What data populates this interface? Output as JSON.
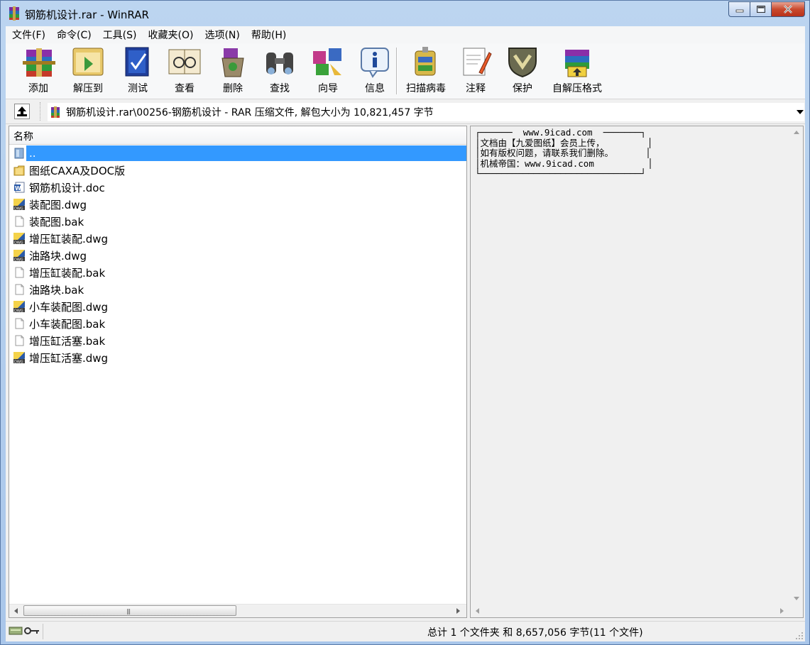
{
  "window": {
    "title": "钢筋机设计.rar - WinRAR"
  },
  "menu": [
    "文件(F)",
    "命令(C)",
    "工具(S)",
    "收藏夹(O)",
    "选项(N)",
    "帮助(H)"
  ],
  "toolbar": [
    {
      "label": "添加",
      "icon": "add-icon"
    },
    {
      "label": "解压到",
      "icon": "extract-to-icon"
    },
    {
      "label": "测试",
      "icon": "test-icon"
    },
    {
      "label": "查看",
      "icon": "view-icon"
    },
    {
      "label": "删除",
      "icon": "delete-icon"
    },
    {
      "label": "查找",
      "icon": "find-icon"
    },
    {
      "label": "向导",
      "icon": "wizard-icon"
    },
    {
      "label": "信息",
      "icon": "info-icon"
    },
    {
      "label": "扫描病毒",
      "icon": "virus-scan-icon"
    },
    {
      "label": "注释",
      "icon": "comment-icon"
    },
    {
      "label": "保护",
      "icon": "protect-icon"
    },
    {
      "label": "自解压格式",
      "icon": "sfx-icon"
    }
  ],
  "address": {
    "path": "钢筋机设计.rar\\00256-钢筋机设计 - RAR 压缩文件, 解包大小为 10,821,457 字节"
  },
  "filelist": {
    "column_name": "名称",
    "rows": [
      {
        "name": "..",
        "type": "parent",
        "selected": true
      },
      {
        "name": "图纸CAXA及DOC版",
        "type": "folder"
      },
      {
        "name": "钢筋机设计.doc",
        "type": "doc"
      },
      {
        "name": "装配图.dwg",
        "type": "dwg"
      },
      {
        "name": "装配图.bak",
        "type": "file"
      },
      {
        "name": "增压缸装配.dwg",
        "type": "dwg"
      },
      {
        "name": "油路块.dwg",
        "type": "dwg"
      },
      {
        "name": "增压缸装配.bak",
        "type": "file"
      },
      {
        "name": "油路块.bak",
        "type": "file"
      },
      {
        "name": "小车装配图.dwg",
        "type": "dwg"
      },
      {
        "name": "小车装配图.bak",
        "type": "file"
      },
      {
        "name": "增压缸活塞.bak",
        "type": "file"
      },
      {
        "name": "增压缸活塞.dwg",
        "type": "dwg"
      }
    ]
  },
  "comment": {
    "lines": [
      "┌──────  www.9icad.com  ───────┐",
      "│文档由【九爱图纸】会员上传，        │",
      "│如有版权问题，请联系我们删除。      │",
      "│机械帝国：www.9icad.com          │",
      "└──────────────────────────────┘"
    ]
  },
  "status": {
    "summary": "总计 1 个文件夹 和 8,657,056 字节(11 个文件)"
  }
}
